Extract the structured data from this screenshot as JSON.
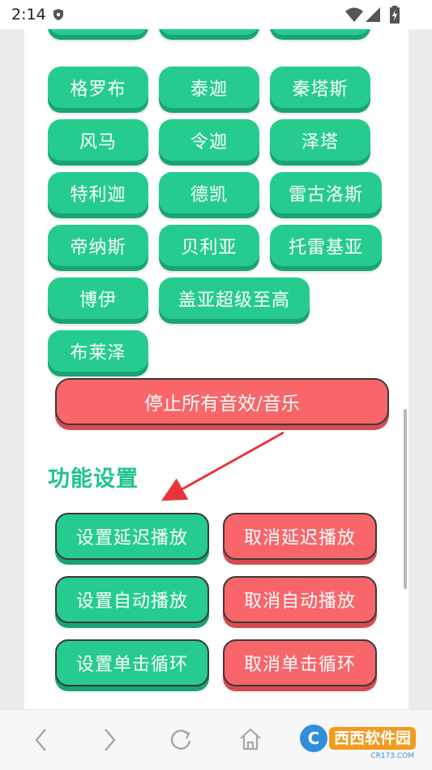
{
  "status_bar": {
    "time": "2:14"
  },
  "hero_buttons": [
    "格罗布",
    "泰迦",
    "秦塔斯",
    "风马",
    "令迦",
    "泽塔",
    "特利迦",
    "德凯",
    "雷古洛斯",
    "帝纳斯",
    "贝利亚",
    "托雷基亚",
    "博伊",
    "盖亚超级至高",
    "布莱泽"
  ],
  "stop_button": "停止所有音效/音乐",
  "section_title": "功能设置",
  "function_buttons": [
    {
      "label": "设置延迟播放",
      "color": "#26cc8e"
    },
    {
      "label": "取消延迟播放",
      "color": "#f8666a"
    },
    {
      "label": "设置自动播放",
      "color": "#26cc8e"
    },
    {
      "label": "取消自动播放",
      "color": "#f8666a"
    },
    {
      "label": "设置单击循环",
      "color": "#26cc8e"
    },
    {
      "label": "取消单击循环",
      "color": "#f8666a"
    }
  ],
  "bottom_nav": {
    "icons": [
      "back-icon",
      "forward-icon",
      "refresh-icon",
      "home-icon"
    ]
  },
  "watermark": {
    "text": "西西软件园",
    "sub": "CR173.COM"
  }
}
